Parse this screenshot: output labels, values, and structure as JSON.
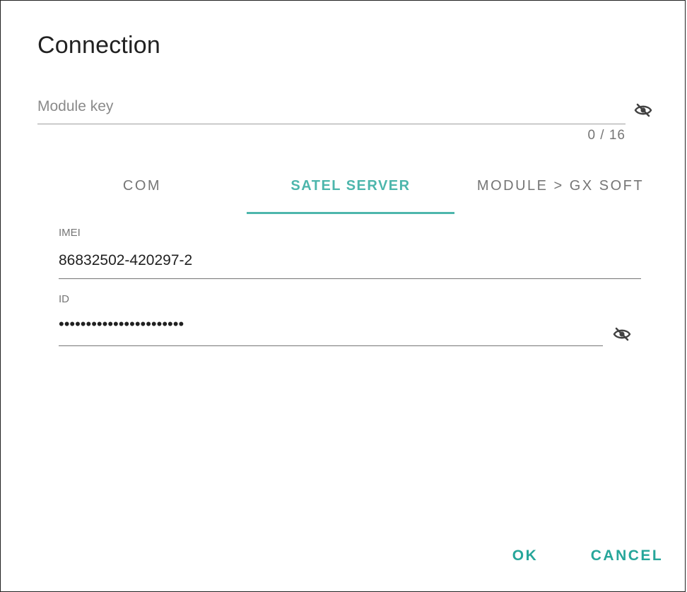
{
  "dialog": {
    "title": "Connection"
  },
  "module_key": {
    "placeholder": "Module key",
    "value": "",
    "counter": "0 / 16",
    "visibility_icon": "eye-off-icon"
  },
  "tabs": [
    {
      "label": "COM",
      "active": false
    },
    {
      "label": "SATEL SERVER",
      "active": true
    },
    {
      "label": "MODULE > GX SOFT",
      "active": false
    }
  ],
  "imei": {
    "label": "IMEI",
    "value": "86832502-420297-2"
  },
  "id_field": {
    "label": "ID",
    "value": "•••••••••••••••••••••••",
    "visibility_icon": "eye-off-icon"
  },
  "actions": {
    "ok_label": "OK",
    "cancel_label": "CANCEL"
  },
  "colors": {
    "accent": "#4db6ac",
    "button_text": "#26a69a",
    "text_primary": "#212121",
    "text_secondary": "#757575"
  }
}
